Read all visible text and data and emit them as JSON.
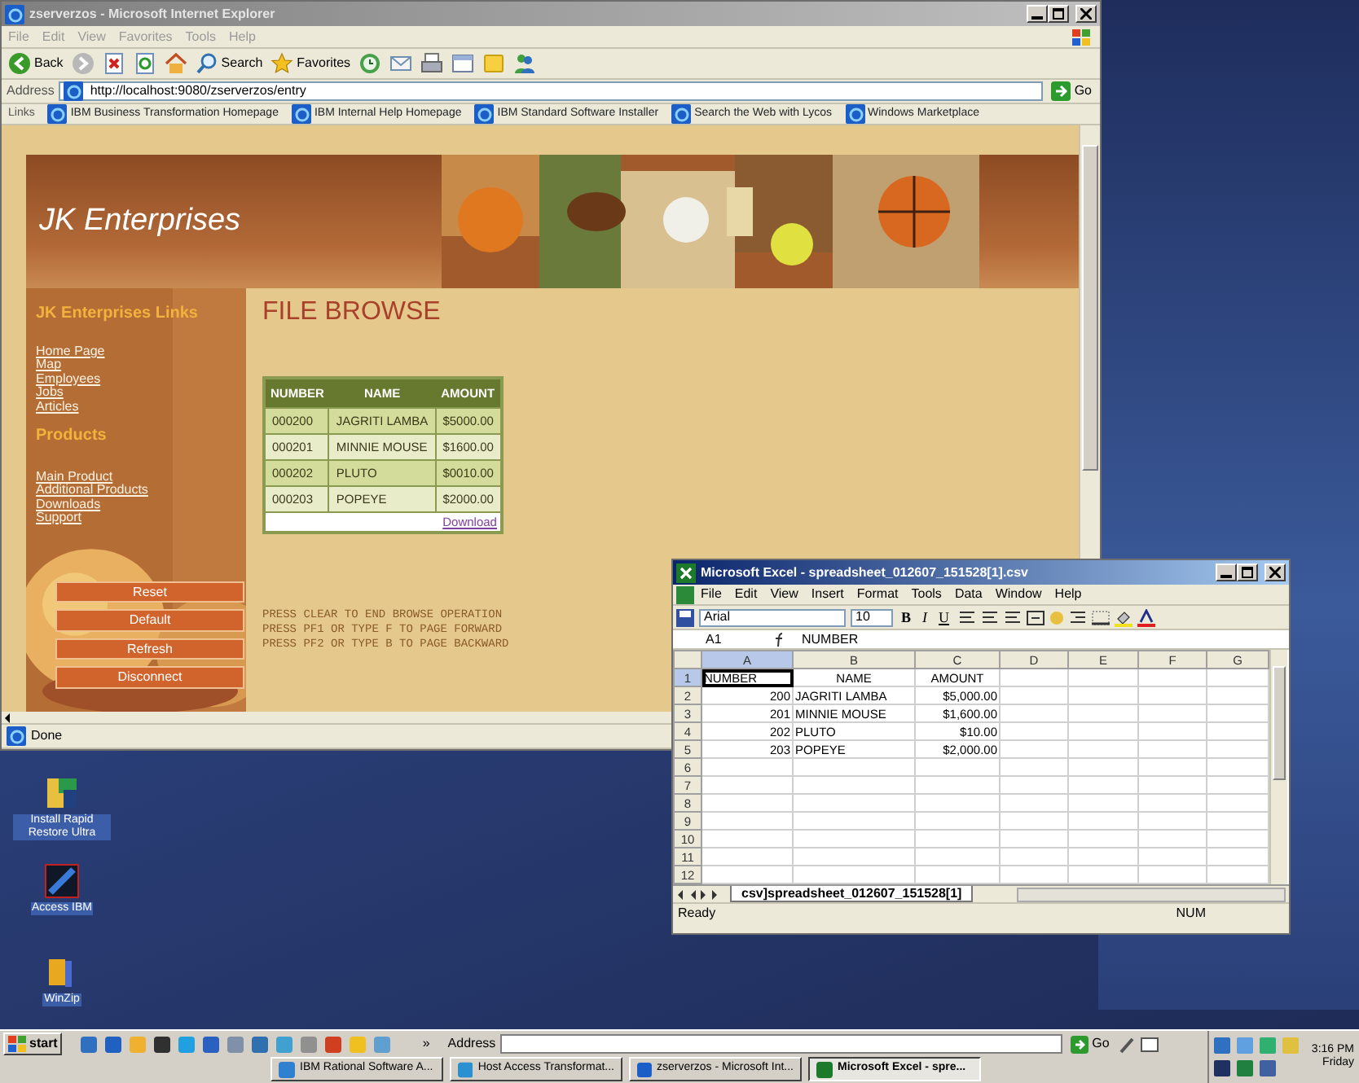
{
  "browser": {
    "title": "zserverzos - Microsoft Internet Explorer",
    "active": false,
    "menu": [
      "File",
      "Edit",
      "View",
      "Favorites",
      "Tools",
      "Help"
    ],
    "toolbar": [
      {
        "kind": "back",
        "label": "Back"
      },
      {
        "kind": "forward"
      },
      {
        "kind": "stop"
      },
      {
        "kind": "refresh"
      },
      {
        "kind": "home"
      },
      {
        "kind": "search",
        "label": "Search"
      },
      {
        "kind": "favorites",
        "label": "Favorites"
      },
      {
        "kind": "history"
      },
      {
        "kind": "mail"
      },
      {
        "kind": "print"
      },
      {
        "kind": "edit"
      },
      {
        "kind": "note"
      },
      {
        "kind": "messenger"
      }
    ],
    "address_label": "Address",
    "address": "http://localhost:9080/zserverzos/entry",
    "go": "Go",
    "links_label": "Links",
    "links": [
      "IBM Business Transformation Homepage",
      "IBM Internal Help Homepage",
      "IBM Standard Software Installer",
      "Search the Web with Lycos",
      "Windows Marketplace"
    ],
    "status": "Done"
  },
  "page": {
    "site_title": "JK Enterprises",
    "links_heading": "JK Enterprises Links",
    "links": [
      "Home Page",
      "Map",
      "Employees",
      "Jobs",
      "Articles"
    ],
    "products_heading": "Products",
    "product_links": [
      "Main Product",
      "Additional Products",
      "Downloads",
      "Support"
    ],
    "buttons": [
      "Reset",
      "Default",
      "Refresh",
      "Disconnect"
    ],
    "heading": "FILE BROWSE",
    "table": {
      "columns": [
        "NUMBER",
        "NAME",
        "AMOUNT"
      ],
      "rows": [
        [
          "000200",
          "JAGRITI LAMBA",
          "$5000.00"
        ],
        [
          "000201",
          "MINNIE MOUSE",
          "$1600.00"
        ],
        [
          "000202",
          "PLUTO",
          "$0010.00"
        ],
        [
          "000203",
          "POPEYE",
          "$2000.00"
        ]
      ]
    },
    "download": "Download",
    "messages": [
      "PRESS CLEAR TO END BROWSE OPERATION",
      "PRESS PF1 OR TYPE F TO PAGE FORWARD",
      "PRESS PF2 OR TYPE B TO PAGE BACKWARD"
    ]
  },
  "excel": {
    "title": "Microsoft Excel - spreadsheet_012607_151528[1].csv",
    "active": true,
    "menu": [
      "File",
      "Edit",
      "View",
      "Insert",
      "Format",
      "Tools",
      "Data",
      "Window",
      "Help"
    ],
    "font": "Arial",
    "size": "10",
    "format_buttons": [
      "B",
      "I",
      "U"
    ],
    "name_box": "A1",
    "formula": "NUMBER",
    "columns": [
      "A",
      "B",
      "C",
      "D",
      "E",
      "F",
      "G"
    ],
    "row_numbers": [
      "1",
      "2",
      "3",
      "4",
      "5",
      "6",
      "7",
      "8",
      "9",
      "10",
      "11",
      "12"
    ],
    "rows": [
      {
        "kind": "header",
        "cells": [
          {
            "text": "NUMBER",
            "selected": true
          },
          {
            "text": "NAME",
            "selected": false
          },
          {
            "text": "AMOUNT",
            "selected": false
          }
        ]
      },
      {
        "kind": "data",
        "cells": [
          {
            "text": "200",
            "selected": false
          },
          {
            "text": "JAGRITI LAMBA",
            "selected": false
          },
          {
            "text": "$5,000.00",
            "selected": false
          }
        ]
      },
      {
        "kind": "data",
        "cells": [
          {
            "text": "201",
            "selected": false
          },
          {
            "text": "MINNIE MOUSE",
            "selected": false
          },
          {
            "text": "$1,600.00",
            "selected": false
          }
        ]
      },
      {
        "kind": "data",
        "cells": [
          {
            "text": "202",
            "selected": false
          },
          {
            "text": "PLUTO",
            "selected": false
          },
          {
            "text": "$10.00",
            "selected": false
          }
        ]
      },
      {
        "kind": "data",
        "cells": [
          {
            "text": "203",
            "selected": false
          },
          {
            "text": "POPEYE",
            "selected": false
          },
          {
            "text": "$2,000.00",
            "selected": false
          }
        ]
      }
    ],
    "sheet_tab": "csv]spreadsheet_012607_151528[1]",
    "status": "Ready",
    "num": "NUM"
  },
  "desktop_icons": [
    {
      "kind": "restore",
      "label": "Install Rapid Restore Ultra"
    },
    {
      "kind": "access",
      "label": "Access IBM"
    },
    {
      "kind": "zip",
      "label": "WinZip"
    }
  ],
  "taskbar": {
    "start": "start",
    "more": "»",
    "address_label": "Address",
    "go": "Go",
    "tasks": [
      {
        "label": "IBM Rational Software A...",
        "selected": false
      },
      {
        "label": "Host Access Transformat...",
        "selected": false
      },
      {
        "label": "zserverzos - Microsoft Int...",
        "selected": false
      },
      {
        "label": "Microsoft Excel - spre...",
        "selected": true
      }
    ],
    "time": "3:16 PM",
    "day": "Friday"
  }
}
